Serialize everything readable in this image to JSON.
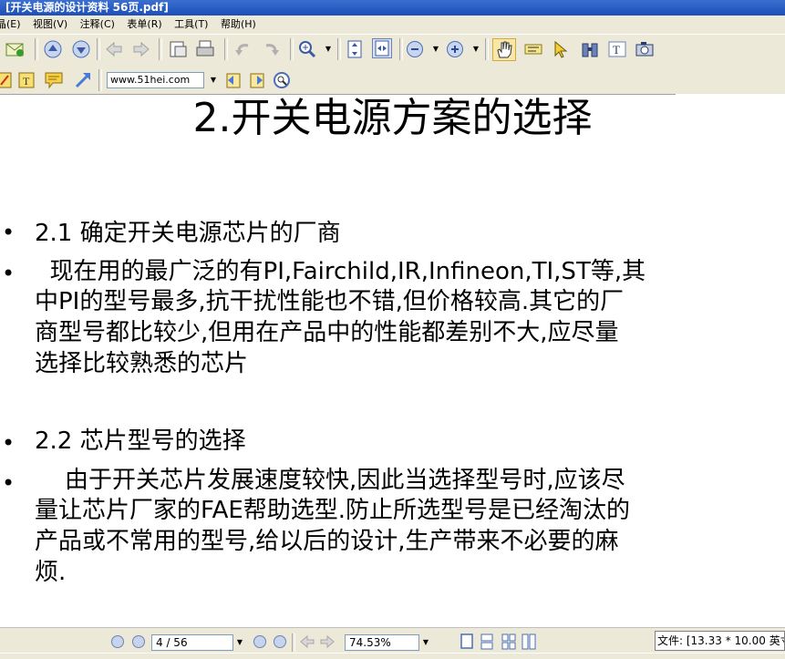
{
  "window": {
    "title": "[开关电源的设计资料 56页.pdf]"
  },
  "menu": {
    "items": [
      "晶(E)",
      "视图(V)",
      "注释(C)",
      "表单(R)",
      "工具(T)",
      "帮助(H)"
    ]
  },
  "toolbar": {
    "address": "www.51hei.com",
    "icons": [
      "email-icon",
      "page-up-icon",
      "page-down-icon",
      "back-icon",
      "forward-icon",
      "save-icon",
      "print-icon",
      "undo-icon",
      "redo-icon",
      "zoom-in-icon",
      "fit-page-icon",
      "fit-width-icon",
      "zoom-out-icon",
      "zoom-plus-icon",
      "hand-tool-icon",
      "text-select-icon",
      "arrow-tool-icon",
      "binoculars-icon",
      "text-tool-icon",
      "snapshot-icon",
      "note-icon",
      "text-box-icon",
      "comment-icon",
      "arrow-link-icon",
      "bookmark-back-icon",
      "bookmark-forward-icon",
      "search-icon"
    ]
  },
  "document": {
    "title": "2.开关电源方案的选择",
    "sections": [
      {
        "bullet": "•",
        "text": "2.1 确定开关电源芯片的厂商"
      },
      {
        "bullet": "•",
        "lines": [
          "  现在用的最广泛的有PI,Fairchild,IR,Infineon,TI,ST等,其",
          "中PI的型号最多,抗干扰性能也不错,但价格较高.其它的厂",
          "商型号都比较少,但用在产品中的性能都差别不大,应尽量",
          "选择比较熟悉的芯片"
        ]
      },
      {
        "bullet": "•",
        "text": "2.2 芯片型号的选择"
      },
      {
        "bullet": "•",
        "lines": [
          "    由于开关芯片发展速度较快,因此当选择型号时,应该尽",
          "量让芯片厂家的FAE帮助选型.防止所选型号是已经淘汰的",
          "产品或不常用的型号,给以后的设计,生产带来不必要的麻",
          "烦."
        ]
      }
    ]
  },
  "status": {
    "page": "4 / 56",
    "zoom": "74.53%",
    "info": "文件: [13.33 * 10.00 英寸"
  }
}
